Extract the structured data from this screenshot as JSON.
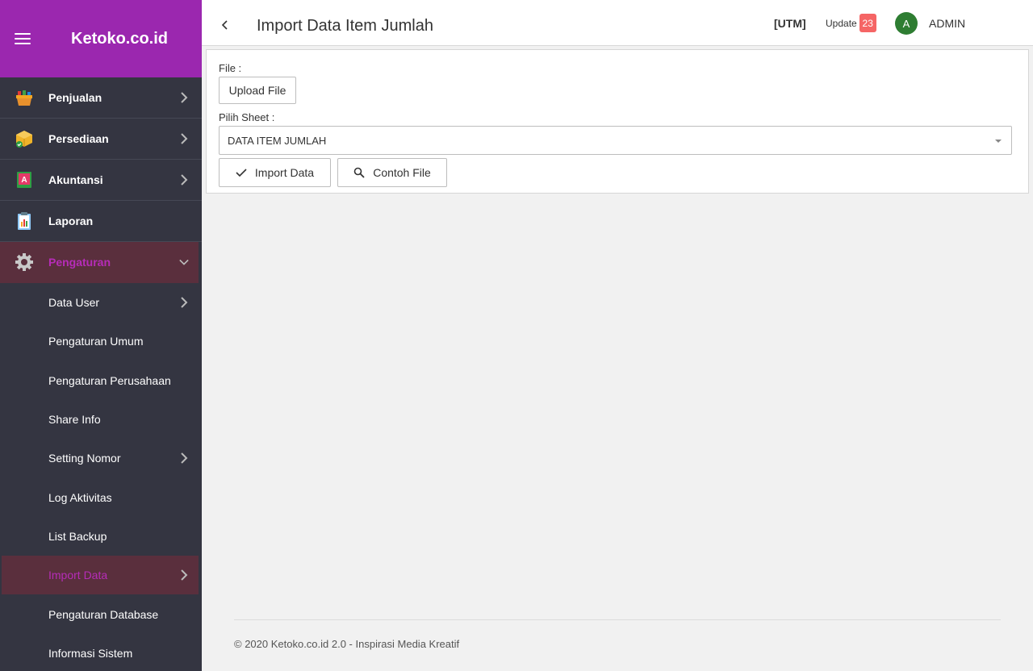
{
  "app": {
    "brand": "Ketoko.co.id"
  },
  "sidebar": {
    "items": [
      {
        "label": "Penjualan"
      },
      {
        "label": "Persediaan"
      },
      {
        "label": "Akuntansi"
      },
      {
        "label": "Laporan"
      },
      {
        "label": "Pengaturan"
      }
    ],
    "submenu": [
      {
        "label": "Data User"
      },
      {
        "label": "Pengaturan Umum"
      },
      {
        "label": "Pengaturan Perusahaan"
      },
      {
        "label": "Share Info"
      },
      {
        "label": "Setting Nomor"
      },
      {
        "label": "Log Aktivitas"
      },
      {
        "label": "List Backup"
      },
      {
        "label": "Import Data"
      },
      {
        "label": "Pengaturan Database"
      },
      {
        "label": "Informasi Sistem"
      }
    ]
  },
  "header": {
    "title": "Import Data Item Jumlah",
    "utm": "[UTM]",
    "update_label": "Update",
    "update_count": "23",
    "avatar_initial": "A",
    "user_name": "ADMIN"
  },
  "form": {
    "file_label": "File :",
    "upload_button": "Upload File",
    "sheet_label": "Pilih Sheet :",
    "sheet_value": "DATA ITEM JUMLAH",
    "import_button": "Import Data",
    "example_button": "Contoh File"
  },
  "footer": {
    "text": "© 2020 Ketoko.co.id 2.0 - Inspirasi Media Kreatif"
  },
  "colors": {
    "brand": "#9b27af",
    "sidebar": "#343541",
    "active_bg": "#5a2f3d",
    "active_text": "#b62cb8",
    "badge": "#f56565",
    "avatar": "#2e7d32"
  }
}
